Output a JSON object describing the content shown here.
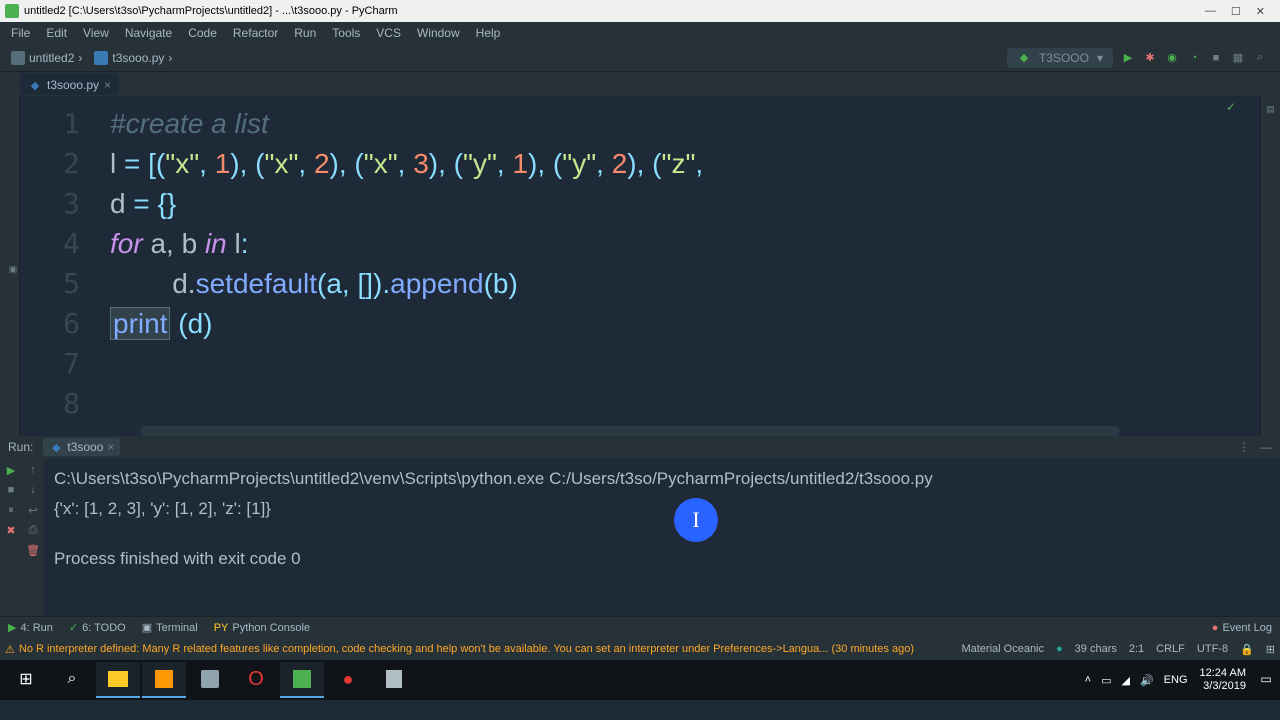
{
  "title": "untitled2 [C:\\Users\\t3so\\PycharmProjects\\untitled2] - ...\\t3sooo.py - PyCharm",
  "menu": [
    "File",
    "Edit",
    "View",
    "Navigate",
    "Code",
    "Refactor",
    "Run",
    "Tools",
    "VCS",
    "Window",
    "Help"
  ],
  "breadcrumb": {
    "project": "untitled2",
    "file": "t3sooo.py"
  },
  "run_config": "T3SOOO",
  "tab": {
    "name": "t3sooo.py"
  },
  "lines": [
    "1",
    "2",
    "3",
    "4",
    "5",
    "6",
    "7",
    "8"
  ],
  "code": {
    "l1_comment": "#create a list",
    "l2_a": "l ",
    "l2_eq": "= ",
    "l2_b": "[(",
    "l2_s1": "\"x\"",
    "l2_c": ", ",
    "l2_n1": "1",
    "l2_d": "), (",
    "l2_s2": "\"x\"",
    "l2_n2": "2",
    "l2_s3": "\"x\"",
    "l2_n3": "3",
    "l2_s4": "\"y\"",
    "l2_n4": "1",
    "l2_s5": "\"y\"",
    "l2_n5": "2",
    "l2_s6": "\"z\"",
    "l2_tail": ",",
    "l3_a": "d ",
    "l3_eq": "= ",
    "l3_b": "{}",
    "l4_for": "for ",
    "l4_ab": "a, b ",
    "l4_in": "in ",
    "l4_l": "l",
    "l4_c": ":",
    "l5_pad": "        ",
    "l5_a": "d.",
    "l5_fn": "setdefault",
    "l5_b": "(a, []).",
    "l5_fn2": "append",
    "l5_c": "(b)",
    "l6_print": "print",
    "l6_b": " (d)"
  },
  "run": {
    "label": "Run:",
    "tabname": "t3sooo",
    "cmd": "C:\\Users\\t3so\\PycharmProjects\\untitled2\\venv\\Scripts\\python.exe C:/Users/t3so/PycharmProjects/untitled2/t3sooo.py",
    "out": "{'x': [1, 2, 3], 'y': [1, 2], 'z': [1]}",
    "exit": "Process finished with exit code 0"
  },
  "bottom": {
    "run": "4: Run",
    "todo": "6: TODO",
    "terminal": "Terminal",
    "pyconsole": "Python Console",
    "eventlog": "Event Log"
  },
  "status": {
    "warn": "No R interpreter defined: Many R related features like completion, code checking and help won't be available. You can set an interpreter under Preferences->Langua... (30 minutes ago)",
    "theme": "Material Oceanic",
    "chars": "39 chars",
    "pos": "2:1",
    "eol": "CRLF",
    "enc": "UTF-8"
  },
  "tray": {
    "ime": "ENG",
    "time": "12:24 AM",
    "date": "3/3/2019"
  }
}
